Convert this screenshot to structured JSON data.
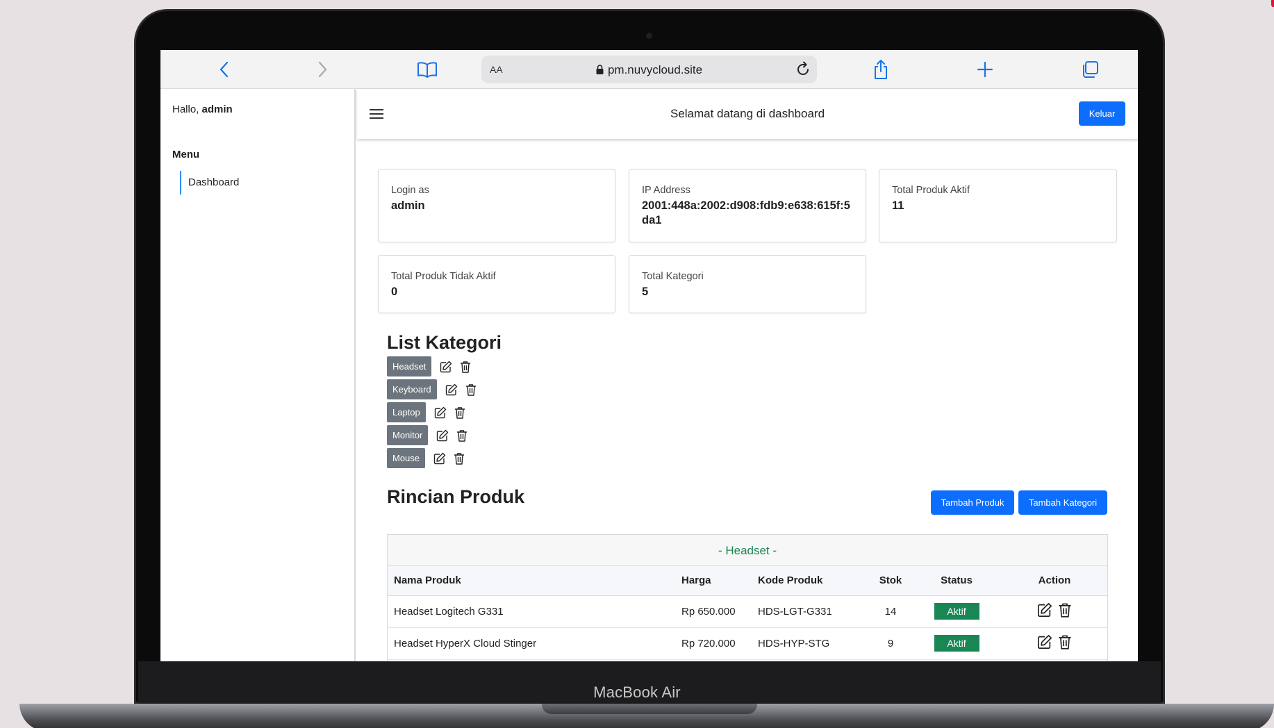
{
  "browser": {
    "aa_label": "AA",
    "url": "pm.nuvycloud.site"
  },
  "device": {
    "brand": "MacBook Air"
  },
  "sidebar": {
    "greeting_prefix": "Hallo, ",
    "username": "admin",
    "menu_title": "Menu",
    "items": [
      {
        "label": "Dashboard"
      }
    ]
  },
  "header": {
    "welcome": "Selamat datang di dashboard",
    "logout_label": "Keluar"
  },
  "cards": [
    {
      "label": "Login as",
      "value": "admin"
    },
    {
      "label": "IP Address",
      "value": "2001:448a:2002:d908:fdb9:e638:615f:5da1"
    },
    {
      "label": "Total Produk Aktif",
      "value": "11"
    },
    {
      "label": "Total Produk Tidak Aktif",
      "value": "0"
    },
    {
      "label": "Total Kategori",
      "value": "5"
    }
  ],
  "categories": {
    "title": "List Kategori",
    "items": [
      "Headset",
      "Keyboard",
      "Laptop",
      "Monitor",
      "Mouse"
    ]
  },
  "products": {
    "title": "Rincian Produk",
    "add_product_label": "Tambah Produk",
    "add_category_label": "Tambah Kategori",
    "group_title": "- Headset -",
    "columns": [
      "Nama Produk",
      "Harga",
      "Kode Produk",
      "Stok",
      "Status",
      "Action"
    ],
    "rows": [
      {
        "name": "Headset Logitech G331",
        "price": "Rp 650.000",
        "code": "HDS-LGT-G331",
        "stock": "14",
        "status": "Aktif"
      },
      {
        "name": "Headset HyperX Cloud Stinger",
        "price": "Rp 720.000",
        "code": "HDS-HYP-STG",
        "stock": "9",
        "status": "Aktif"
      }
    ]
  },
  "colors": {
    "primary": "#0d6efd",
    "success": "#198754",
    "badge": "#6c757d"
  }
}
